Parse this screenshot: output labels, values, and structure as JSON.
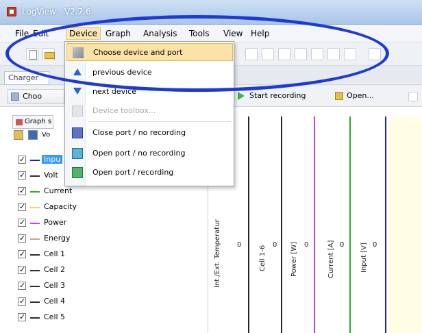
{
  "window": {
    "title": "LogView - V2.7.6"
  },
  "menubar": [
    "File",
    "Edit",
    "Device",
    "Graph",
    "Analysis",
    "Tools",
    "View",
    "Help"
  ],
  "active_menu": "Device",
  "tabs": {
    "truncated_tab": "Charger"
  },
  "toolbar": {
    "choose_label": "Choo",
    "start_recording": "Start recording",
    "open_label": "Open..."
  },
  "left_panel": {
    "graphs_tab": "Graph s",
    "vo_label": "Vo",
    "channels": [
      {
        "name": "Inpu",
        "color": "#1a1ad6",
        "selected": true
      },
      {
        "name": "Volt",
        "color": "#2b2b2b"
      },
      {
        "name": "Current",
        "color": "#22b022"
      },
      {
        "name": "Capacity",
        "color": "#f2d54a"
      },
      {
        "name": "Power",
        "color": "#d43bd4"
      },
      {
        "name": "Energy",
        "color": "#e0a070"
      },
      {
        "name": "Cell 1",
        "color": "#2b2b2b"
      },
      {
        "name": "Cell 2",
        "color": "#2b2b2b"
      },
      {
        "name": "Cell 3",
        "color": "#2b2b2b"
      },
      {
        "name": "Cell 4",
        "color": "#2b2b2b"
      },
      {
        "name": "Cell 5",
        "color": "#2b2b2b"
      }
    ]
  },
  "graph": {
    "axes": [
      {
        "label": "Int./Ext. Temperatur",
        "color": "#222222",
        "zero": "0"
      },
      {
        "label": "Cell 1-6",
        "color": "#222222",
        "zero": "0"
      },
      {
        "label": "Power  [W]",
        "color": "#d43bd4",
        "zero": "0"
      },
      {
        "label": "Current  [A]",
        "color": "#22b022",
        "zero": "0"
      },
      {
        "label": "Input  [V]",
        "color": "#1a1ad6",
        "zero": "0"
      }
    ]
  },
  "device_menu": {
    "items": [
      {
        "label": "Choose device and port",
        "icon": "plug-icon",
        "highlight": true
      },
      {
        "label": "previous device",
        "icon": "arrow-up-icon"
      },
      {
        "label": "next device",
        "icon": "arrow-down-icon"
      },
      {
        "label": "Device toolbox...",
        "icon": "toolbox-icon",
        "disabled": true
      },
      {
        "label": "Close port / no recording",
        "icon": "port-close-icon"
      },
      {
        "label": "Open port / no recording",
        "icon": "port-open-icon"
      },
      {
        "label": "Open port / recording",
        "icon": "port-record-icon"
      }
    ]
  },
  "colors": {
    "highlight": "#fbe3a8",
    "annotation": "#1c3bd6"
  }
}
